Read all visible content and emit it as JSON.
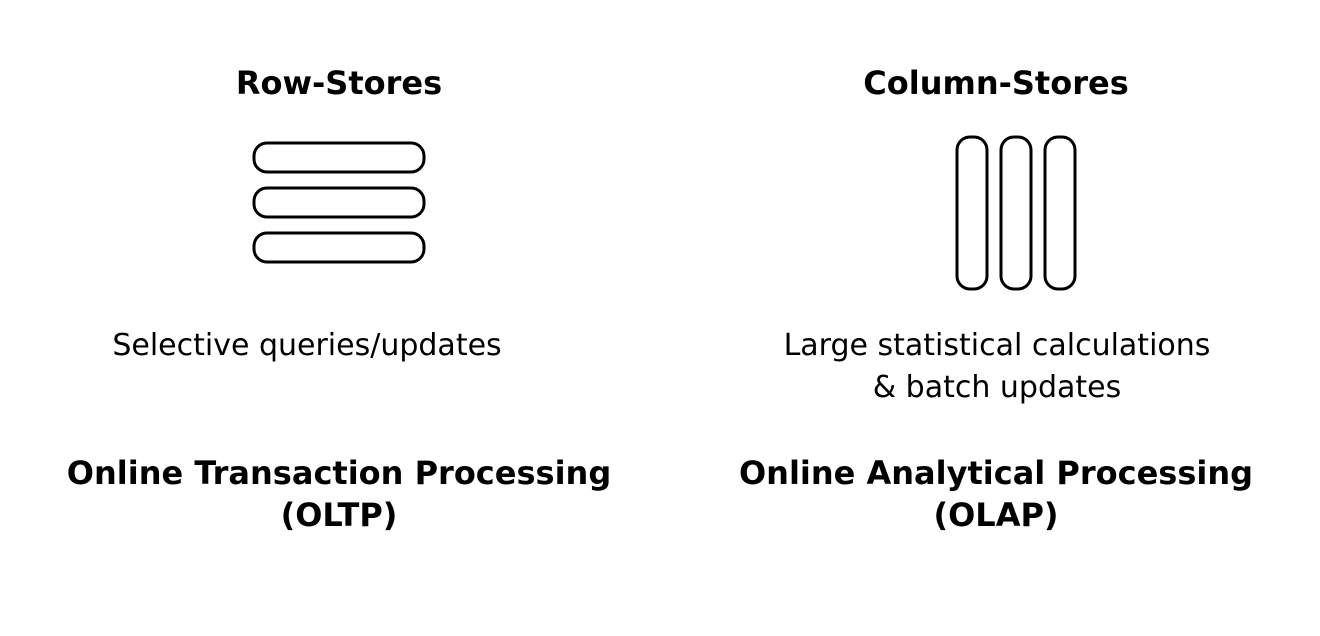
{
  "row_store": {
    "heading": "Row-Stores",
    "icon": "stacked-rows-icon",
    "description": [
      "Selective queries/updates"
    ],
    "category_line1": "Online Transaction Processing",
    "category_line2": "(OLTP)"
  },
  "column_store": {
    "heading": "Column-Stores",
    "icon": "side-by-side-columns-icon",
    "description": [
      "Large statistical calculations",
      "& batch updates"
    ],
    "category_line1": "Online Analytical Processing",
    "category_line2": "(OLAP)"
  }
}
